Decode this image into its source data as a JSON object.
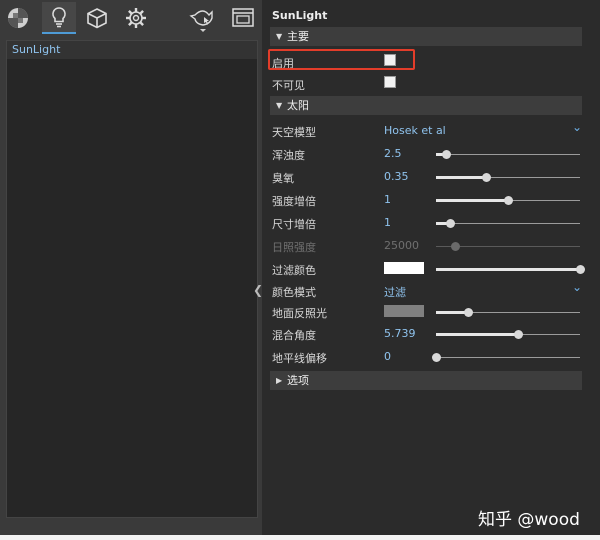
{
  "toolbar": {
    "tabs": [
      {
        "icon": "checkerboard-icon"
      },
      {
        "icon": "lightbulb-icon",
        "active": true
      },
      {
        "icon": "cube-icon"
      },
      {
        "icon": "gear-icon"
      },
      {
        "icon": "render-teapot-icon"
      },
      {
        "icon": "window-icon"
      }
    ]
  },
  "tree": {
    "items": [
      "SunLight"
    ]
  },
  "panel": {
    "title": "SunLight",
    "sections": {
      "main": "主要",
      "sun": "太阳",
      "options": "选项"
    },
    "main_rows": {
      "enable": {
        "label": "启用",
        "checked": false
      },
      "invisible": {
        "label": "不可见",
        "checked": false
      }
    },
    "sun_rows": {
      "sky_model": {
        "label": "天空模型",
        "value": "Hosek et al"
      },
      "turbidity": {
        "label": "浑浊度",
        "value": "2.5",
        "level": 0.07
      },
      "ozone": {
        "label": "臭氧",
        "value": "0.35",
        "level": 0.35
      },
      "intensity_mult": {
        "label": "强度增倍",
        "value": "1",
        "level": 0.5
      },
      "size_mult": {
        "label": "尺寸增倍",
        "value": "1",
        "level": 0.1
      },
      "illuminance": {
        "label": "日照强度",
        "value": "25000",
        "level": 0.13,
        "disabled": true
      },
      "filter_color": {
        "label": "过滤颜色",
        "color": "#ffffff",
        "level": 1.0
      },
      "color_mode": {
        "label": "颜色模式",
        "value": "过滤"
      },
      "ground_albedo": {
        "label": "地面反照光",
        "color": "#808080",
        "level": 0.22
      },
      "blend_angle": {
        "label": "混合角度",
        "value": "5.739",
        "level": 0.57
      },
      "horizon_offset": {
        "label": "地平线偏移",
        "value": "0",
        "level": 0.0
      }
    }
  },
  "watermark": "知乎 @wood",
  "colors": {
    "accent": "#4e9bd6",
    "value_text": "#8fc3ee",
    "highlight_box": "#e23d2a"
  }
}
